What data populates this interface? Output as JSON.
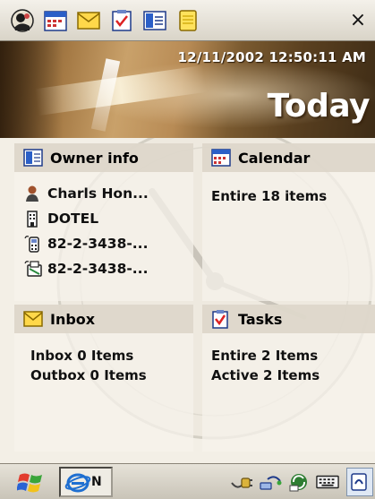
{
  "topbar": {
    "icons": [
      "today-icon",
      "calendar-icon",
      "inbox-icon",
      "tasks-icon",
      "contacts-icon",
      "notes-icon"
    ],
    "close_label": "×"
  },
  "banner": {
    "datetime": "12/11/2002 12:50:11 AM",
    "title": "Today"
  },
  "panels": {
    "owner": {
      "title": "Owner info",
      "name": "Charls Hon...",
      "company": "DOTEL",
      "phone": "82-2-3438-...",
      "fax": "82-2-3438-..."
    },
    "calendar": {
      "title": "Calendar",
      "lines": [
        "Entire 18 items"
      ]
    },
    "inbox": {
      "title": "Inbox",
      "lines": [
        "Inbox 0 Items",
        "Outbox 0 Items"
      ]
    },
    "tasks": {
      "title": "Tasks",
      "lines": [
        "Entire 2 Items",
        "Active 2 Items"
      ]
    }
  },
  "taskbar": {
    "ie_label": "N",
    "tray_icons": [
      "power-plug-icon",
      "network-icon",
      "sync-icon",
      "keyboard-icon"
    ]
  },
  "colors": {
    "panel_header": "#dad4c7",
    "content_bg": "#f3efe6"
  }
}
